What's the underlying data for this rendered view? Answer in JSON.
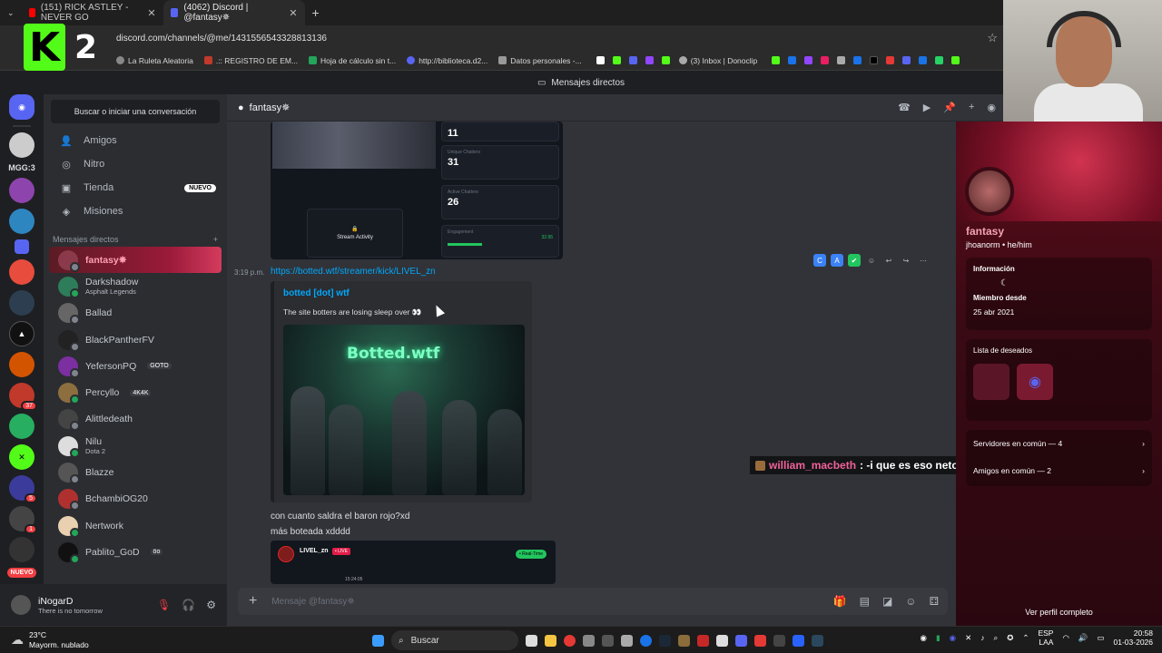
{
  "browser": {
    "tabs": [
      {
        "label": "(151) RICK ASTLEY - NEVER GO",
        "color": "#ff0000"
      },
      {
        "label": "(4062) Discord | @fantasy✵",
        "color": "#5865f2"
      }
    ],
    "url": "discord.com/channels/@me/1431556543328813136",
    "bookmarks": [
      "La Ruleta Aleatoria",
      ".:: REGISTRO DE EM...",
      "Hoja de cálculo sin t...",
      "http://biblioteca.d2...",
      "Datos personales -...",
      "(3) Inbox | Donoclip"
    ]
  },
  "overlay_logo": {
    "letter": "K",
    "number": "2"
  },
  "discord": {
    "title": "Mensajes directos",
    "server_label": "MGG:3",
    "server_new": "NUEVO",
    "search_placeholder": "Buscar o iniciar una conversación",
    "nav": [
      {
        "label": "Amigos",
        "icon": "friends-icon"
      },
      {
        "label": "Nitro",
        "icon": "nitro-icon"
      },
      {
        "label": "Tienda",
        "icon": "shop-icon",
        "badge": "NUEVO"
      },
      {
        "label": "Misiones",
        "icon": "quests-icon"
      }
    ],
    "dm_header": "Mensajes directos",
    "dms": [
      {
        "name": "fantasy✵",
        "sub": ""
      },
      {
        "name": "Darkshadow",
        "sub": "Asphalt Legends"
      },
      {
        "name": "Ballad",
        "sub": ""
      },
      {
        "name": "BlackPantherFV",
        "sub": ""
      },
      {
        "name": "YefersonPQ",
        "sub": "",
        "tag": "GOTO"
      },
      {
        "name": "Percyllo",
        "sub": "",
        "tag": "4K4K"
      },
      {
        "name": "Alittledeath",
        "sub": ""
      },
      {
        "name": "Nilu",
        "sub": "Dota 2"
      },
      {
        "name": "Blazze",
        "sub": ""
      },
      {
        "name": "BchambiOG20",
        "sub": ""
      },
      {
        "name": "Nertwork",
        "sub": ""
      },
      {
        "name": "Pablito_GoD",
        "sub": "",
        "tag": "öo"
      }
    ],
    "user": {
      "name": "iNogarD",
      "status": "There is no tomorrow"
    },
    "channel_name": "fantasy✵",
    "chat": {
      "stats": [
        {
          "label": "",
          "value": "11"
        },
        {
          "label": "Unique Chatters",
          "value": "31"
        },
        {
          "label": "Active Chatters",
          "value": "26"
        },
        {
          "label": "Engagement",
          "value": "32.95"
        }
      ],
      "stream_activity": "Stream Activity",
      "timestamp": "3:19 p.m.",
      "link": "https://botted.wtf/streamer/kick/LIVEL_zn",
      "embed_provider": "botted [dot] wtf",
      "embed_desc": "The site botters are losing sleep over 👀",
      "embed_image_text": "Botted.wtf",
      "msg1": "con cuanto saldra el baron rojo?xd",
      "msg2": "más boteada xdddd",
      "card_name": "LIVEL_zn",
      "card_live": "• LIVE",
      "card_realtime": "• Real-Time",
      "card_small": "15:24:05",
      "input_placeholder": "Mensaje @fantasy✵"
    },
    "profile": {
      "display_name": "fantasy",
      "username": "jhoanorm • he/him",
      "info_label": "Información",
      "member_since_label": "Miembro desde",
      "member_since": "25 abr 2021",
      "wishlist_label": "Lista de deseados",
      "mutual_servers": "Servidores en común — 4",
      "mutual_friends": "Amigos en común — 2",
      "view_full": "Ver perfil completo"
    }
  },
  "stream_chat": {
    "user": "william_macbeth",
    "message": ": -i que es eso neto?"
  },
  "taskbar": {
    "temp": "23°C",
    "weather": "Mayorm. nublado",
    "search": "Buscar",
    "lang1": "ESP",
    "lang2": "LAA",
    "time": "20:58",
    "date": "01-03-2026"
  }
}
